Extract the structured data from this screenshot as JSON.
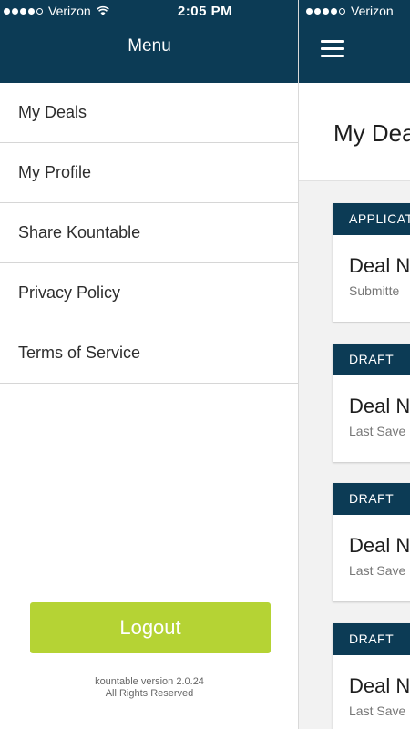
{
  "status_bar": {
    "carrier": "Verizon",
    "time": "2:05 PM",
    "signal_dots_filled": 4,
    "signal_dots_total": 5
  },
  "drawer": {
    "title": "Menu",
    "items": [
      {
        "label": "My Deals"
      },
      {
        "label": "My Profile"
      },
      {
        "label": "Share Kountable"
      },
      {
        "label": "Privacy Policy"
      },
      {
        "label": "Terms of Service"
      }
    ],
    "logout_label": "Logout",
    "version_line": "kountable version 2.0.24",
    "rights_line": "All Rights Reserved"
  },
  "main": {
    "page_title": "My Dea",
    "cards": [
      {
        "status": "APPLICAT",
        "name": "Deal N",
        "subtitle": "Submitte"
      },
      {
        "status": "DRAFT",
        "name": "Deal N",
        "subtitle": "Last Save"
      },
      {
        "status": "DRAFT",
        "name": "Deal N",
        "subtitle": "Last Save"
      },
      {
        "status": "DRAFT",
        "name": "Deal N",
        "subtitle": "Last Save"
      }
    ]
  },
  "colors": {
    "header": "#0c3b55",
    "accent": "#b5d334",
    "background": "#f2f2f2"
  },
  "icons": {
    "menu": "hamburger-icon",
    "wifi": "wifi-icon"
  }
}
